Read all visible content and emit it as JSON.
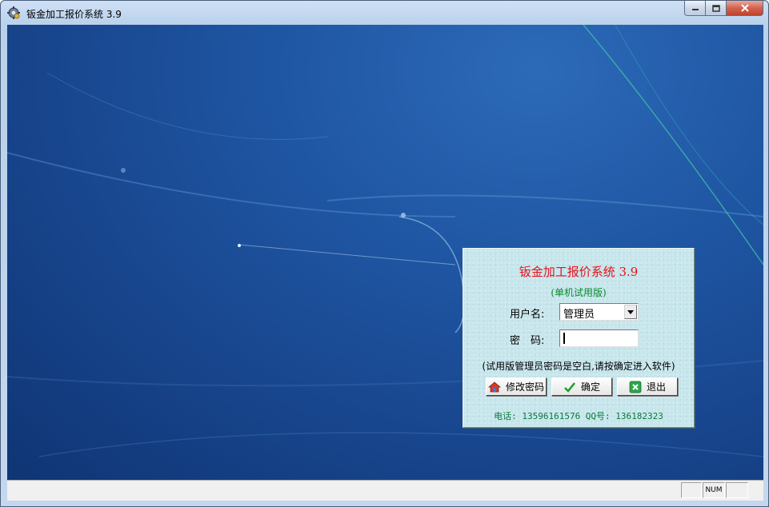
{
  "window": {
    "title": "钣金加工报价系统 3.9",
    "icon": "gear-app-icon",
    "controls": [
      "minimize-icon",
      "maximize-icon",
      "close-icon"
    ]
  },
  "login": {
    "title": "钣金加工报价系统 3.9",
    "subtitle": "(单机试用版)",
    "username_label": "用户名:",
    "username_value": "管理员",
    "password_label": "密　码:",
    "password_value": "",
    "hint": "(试用版管理员密码是空白,请按确定进入软件)",
    "buttons": {
      "change_password": "修改密码",
      "ok": "确定",
      "exit": "退出"
    },
    "contact": "电话: 13596161576  QQ号: 136182323"
  },
  "statusbar": {
    "num": "NUM"
  },
  "colors": {
    "title_red": "#e8101a",
    "subtitle_green": "#0a8a2a",
    "dialog_bg": "#c7e6ec",
    "desktop_blue": "#1f56a3"
  }
}
